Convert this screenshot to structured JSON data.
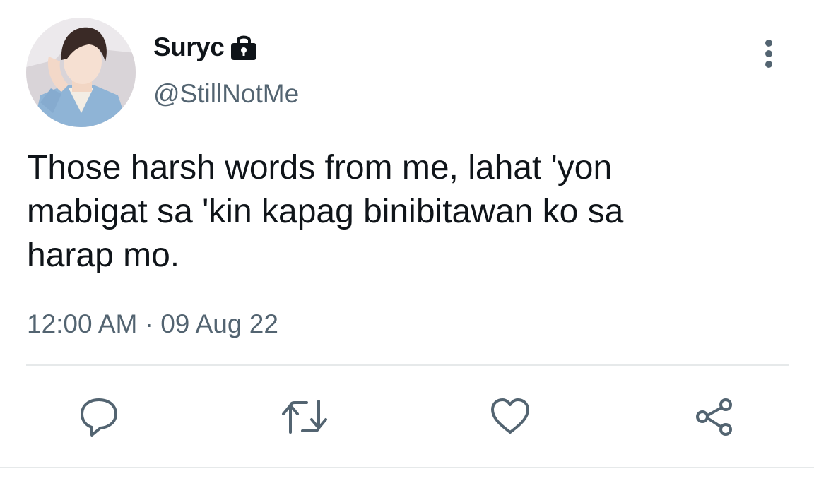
{
  "author": {
    "display_name": "Suryc",
    "handle": "@StillNotMe",
    "protected_icon": "lock-icon",
    "avatar_icon": "profile-photo"
  },
  "tweet": {
    "text": "Those harsh words from me, lahat 'yon\nmabigat sa 'kin kapag binibitawan ko sa\nharap mo.",
    "time": "12:00 AM",
    "separator": "·",
    "date": "09 Aug 22"
  },
  "actions": [
    {
      "icon": "reply-icon"
    },
    {
      "icon": "retweet-icon"
    },
    {
      "icon": "like-icon"
    },
    {
      "icon": "share-icon"
    }
  ],
  "menu": {
    "icon": "more-vertical-icon"
  },
  "colors": {
    "text_primary": "#0f1419",
    "text_secondary": "#536471",
    "icon": "#536471",
    "divider": "#e6e9ea"
  }
}
